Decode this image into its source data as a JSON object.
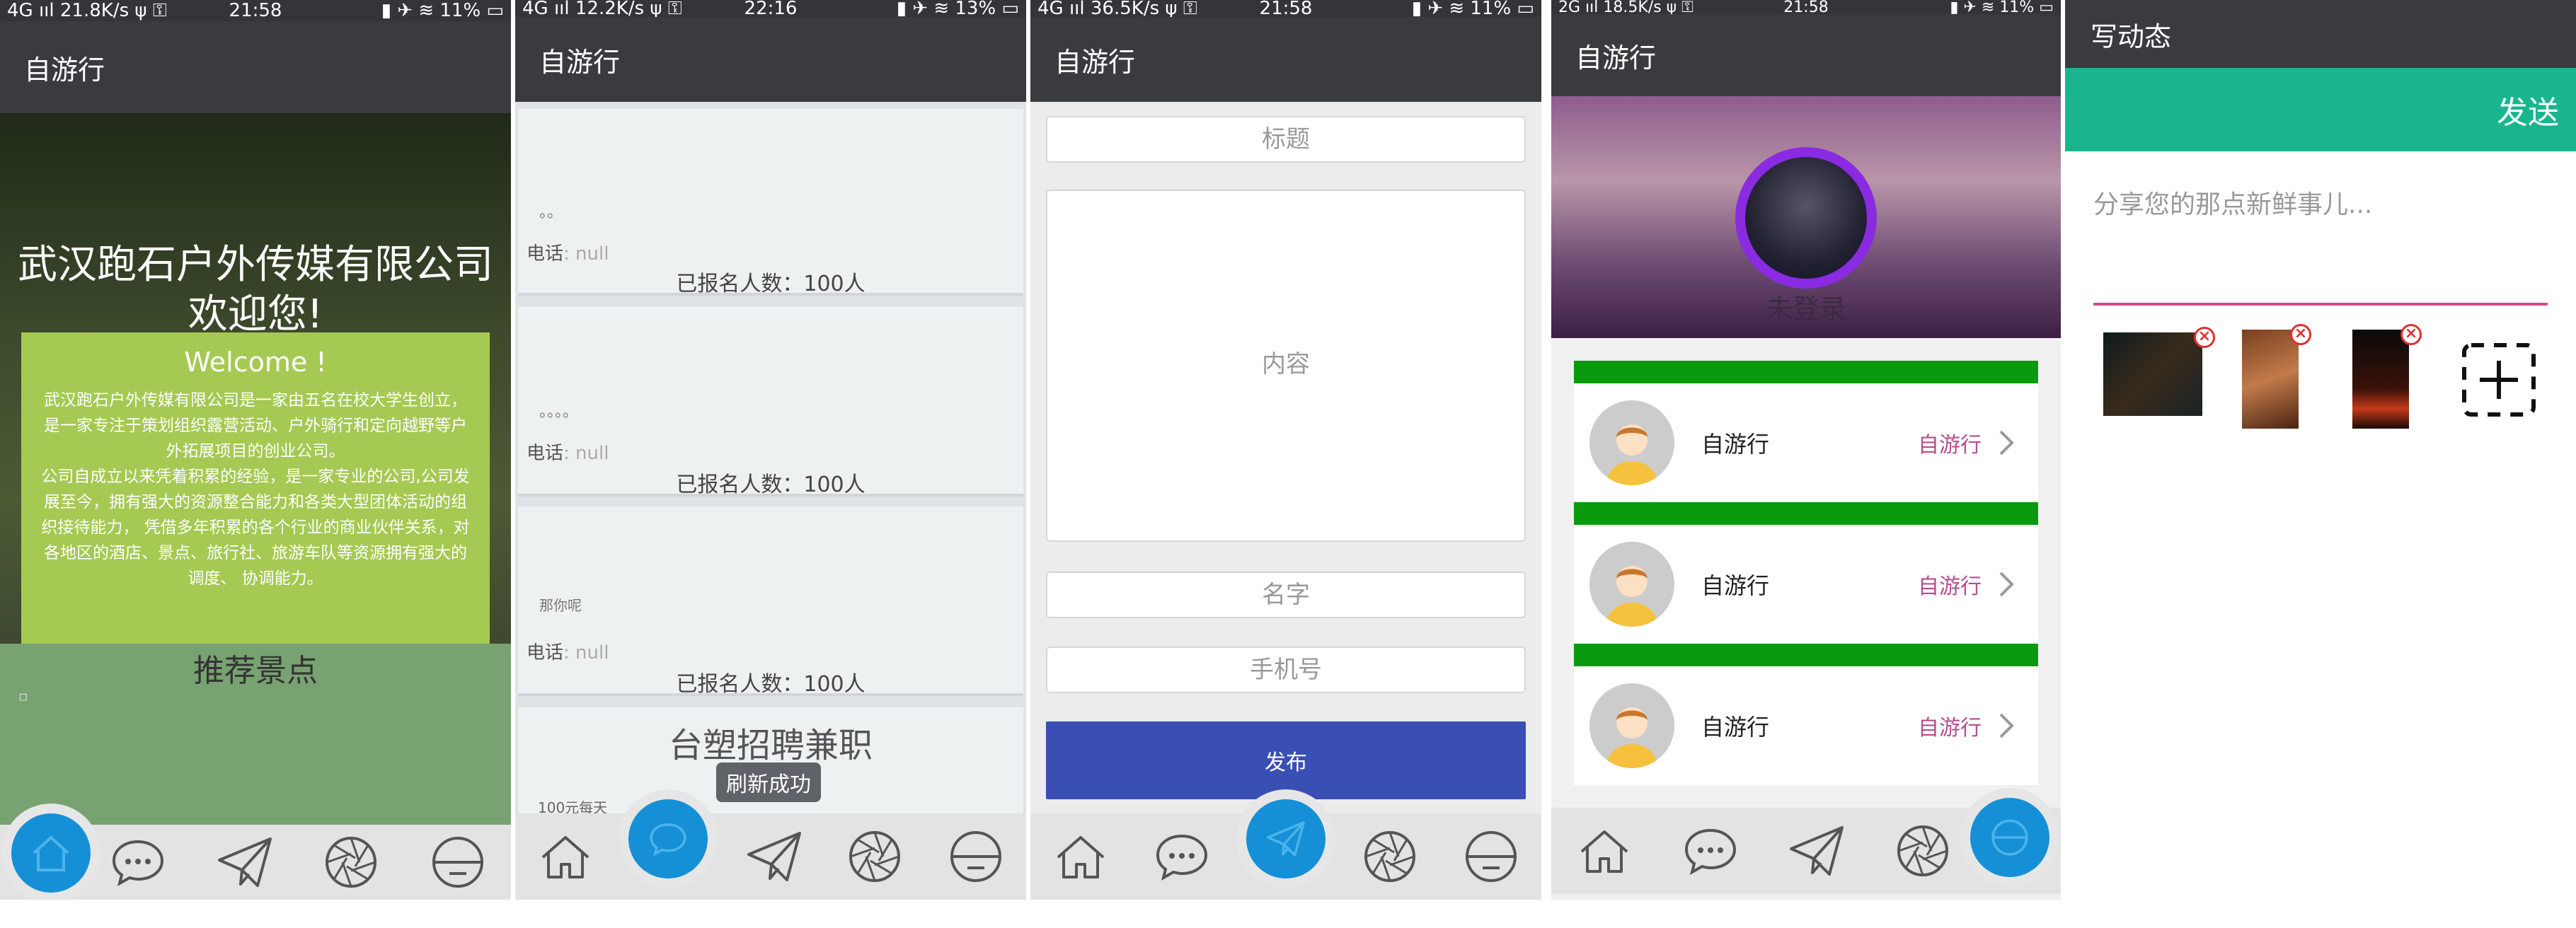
{
  "screen1": {
    "status": {
      "left": "4G ııl 21.8K/s ψ ⚿",
      "time": "21:58",
      "right": "▮ ✈ ≋ 11% ▭"
    },
    "app_title": "自游行",
    "hero_title": "武汉跑石户外传媒有限公司欢迎您!",
    "welcome_title": "Welcome !",
    "welcome_p1": "武汉跑石户外传媒有限公司是一家由五名在校大学生创立，是一家专注于策划组织露营活动、户外骑行和定向越野等户外拓展项目的创业公司。",
    "welcome_p2": "公司自成立以来凭着积累的经验，是一家专业的公司,公司发展至今，拥有强大的资源整合能力和各类大型团体活动的组织接待能力， 凭借多年积累的各个行业的商业伙伴关系，对各地区的酒店、景点、旅行社、旅游车队等资源拥有强大的调度、 协调能力。",
    "recommend_title": "推荐景点",
    "recommend_dot": "▫"
  },
  "screen2": {
    "status": {
      "left": "4G ııl 12.2K/s ψ ⚿",
      "time": "22:16",
      "right": "▮ ✈ ≋ 13% ▭"
    },
    "app_title": "自游行",
    "cards": [
      {
        "dots": "。。",
        "phone_label": "电话",
        "phone_value": ": null",
        "count": "已报名人数：100人"
      },
      {
        "dots": "。。。。",
        "phone_label": "电话",
        "phone_value": ": null",
        "count": "已报名人数：100人"
      },
      {
        "dots": "那你呢",
        "phone_label": "电话",
        "phone_value": ": null",
        "count": "已报名人数：100人"
      }
    ],
    "partial_card_title": "台塑招聘兼职",
    "partial_card_price": "100元每天",
    "toast": "刷新成功"
  },
  "screen3": {
    "status": {
      "left": "4G ııl 36.5K/s ψ ⚿",
      "time": "21:58",
      "right": "▮ ✈ ≋ 11% ▭"
    },
    "app_title": "自游行",
    "title_placeholder": "标题",
    "content_placeholder": "内容",
    "name_placeholder": "名字",
    "phone_placeholder": "手机号",
    "publish_label": "发布"
  },
  "screen4": {
    "status": {
      "left": "2G ııl 18.5K/s ψ ⚿",
      "time": "21:58",
      "right": "▮ ✈ ≋ 11% ▭"
    },
    "app_title": "自游行",
    "login_status": "未登录",
    "rows": [
      {
        "name": "自游行",
        "tag": "自游行"
      },
      {
        "name": "自游行",
        "tag": "自游行"
      },
      {
        "name": "自游行",
        "tag": "自游行"
      }
    ]
  },
  "screen5": {
    "title": "写动态",
    "send_label": "发送",
    "compose_placeholder": "分享您的那点新鲜事儿...",
    "add_label": "+"
  },
  "colors": {
    "appbar": "#3a3b3f",
    "fab": "#1590d6",
    "publish": "#3a4fb4",
    "send_bar": "#19b58e",
    "list_bar": "#0a9a0e",
    "tag": "#b84c8c",
    "welcome": "#a5c952"
  },
  "tab_icons": [
    "home-icon",
    "chat-icon",
    "paper-plane-icon",
    "aperture-icon",
    "face-icon"
  ]
}
